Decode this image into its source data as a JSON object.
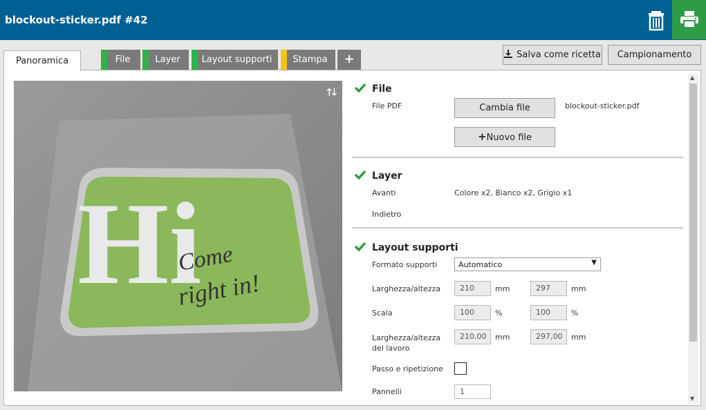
{
  "header": {
    "title": "blockout-sticker.pdf #42"
  },
  "tabs": [
    {
      "label": "Panoramica",
      "marker_color": ""
    },
    {
      "label": "File",
      "marker_color": "#2fb34a"
    },
    {
      "label": "Layer",
      "marker_color": "#2fb34a"
    },
    {
      "label": "Layout supporti",
      "marker_color": "#2fb34a"
    },
    {
      "label": "Stampa",
      "marker_color": "#f3c21b"
    },
    {
      "label": "+",
      "marker_color": ""
    }
  ],
  "actions": {
    "save_recipe": "Salva come ricetta",
    "sampling": "Campionamento"
  },
  "preview": {
    "text_big": "Hi",
    "text_line1": "Come",
    "text_line2": "right in!"
  },
  "sections": {
    "file": {
      "title": "File",
      "pdf_label": "File PDF",
      "change_button": "Cambia file",
      "filename": "blockout-sticker.pdf",
      "new_button": "Nuovo file"
    },
    "layer": {
      "title": "Layer",
      "front_label": "Avanti",
      "front_value": "Colore x2, Bianco x2, Grigio x1",
      "back_label": "Indietro"
    },
    "media": {
      "title": "Layout supporti",
      "format_label": "Formato supporti",
      "format_value": "Automatico",
      "size_label": "Larghezza/altezza",
      "width": "210",
      "height": "297",
      "unit_mm": "mm",
      "scale_label": "Scala",
      "scale_x": "100",
      "scale_y": "100",
      "unit_pct": "%",
      "job_size_label": "Larghezza/altezza del lavoro",
      "job_width": "210,00",
      "job_height": "297,00",
      "step_label": "Passo e ripetizione",
      "panels_label": "Pannelli",
      "panels_value": "1"
    }
  },
  "colors": {
    "header_bg": "#005f93",
    "print_bg": "#2e9b47",
    "check": "#2e9b47",
    "sticker_green": "#8ab85a"
  },
  "icons": [
    "trash-icon",
    "printer-icon",
    "check-icon",
    "arrow-up-icon",
    "arrow-down-icon",
    "download-icon",
    "plus-icon",
    "dropdown-caret-icon"
  ]
}
